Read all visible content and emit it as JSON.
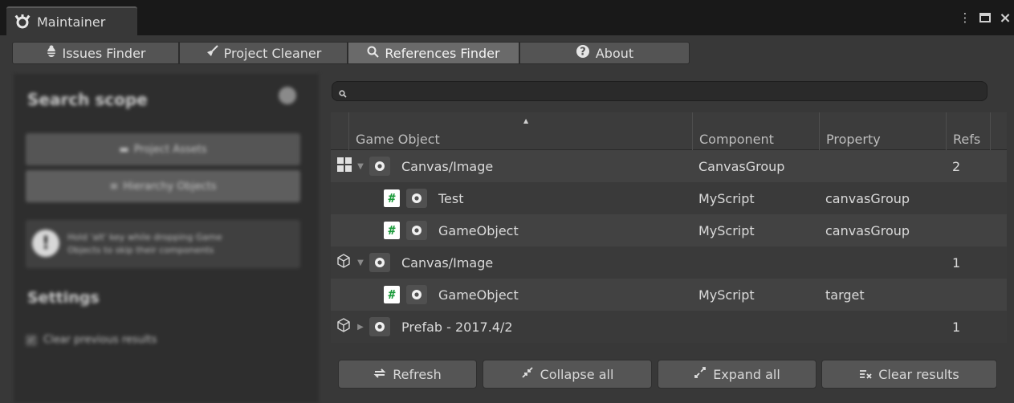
{
  "window": {
    "title": "Maintainer",
    "controls": {
      "menu": "⋮",
      "maximize": "□",
      "close": "×"
    }
  },
  "tabs": [
    {
      "label": "Issues Finder",
      "icon": "bug-icon"
    },
    {
      "label": "Project Cleaner",
      "icon": "broom-icon"
    },
    {
      "label": "References Finder",
      "icon": "search-icon",
      "active": true
    },
    {
      "label": "About",
      "icon": "help-icon"
    }
  ],
  "left_panel": {
    "search_scope_title": "Search scope",
    "project_assets_label": "Project Assets",
    "hierarchy_objects_label": "Hierarchy Objects",
    "note_line1": "Hold 'alt' key while dropping Game",
    "note_line2": "Objects to skip their components",
    "settings_title": "Settings",
    "clear_previous_label": "Clear previous results"
  },
  "search": {
    "placeholder": "",
    "value": ""
  },
  "table": {
    "columns": {
      "game_object": "Game Object",
      "component": "Component",
      "property": "Property",
      "refs": "Refs"
    },
    "sort_indicator": "▲",
    "rows": [
      {
        "icon": "scene-grid-icon",
        "expander": "▼",
        "name": "Canvas/Image",
        "component": "CanvasGroup",
        "property": "",
        "refs": "2"
      },
      {
        "icon": "script-icon",
        "name": "Test",
        "component": "MyScript",
        "property": "canvasGroup",
        "refs": ""
      },
      {
        "icon": "script-icon",
        "name": "GameObject",
        "component": "MyScript",
        "property": "canvasGroup",
        "refs": ""
      },
      {
        "icon": "prefab-cube-icon",
        "expander": "▼",
        "name": "Canvas/Image",
        "component": "",
        "property": "",
        "refs": "1"
      },
      {
        "icon": "script-icon",
        "name": "GameObject",
        "component": "MyScript",
        "property": "target",
        "refs": ""
      },
      {
        "icon": "prefab-cube-icon",
        "expander": "▶",
        "name": "Prefab - 2017.4/2",
        "component": "",
        "property": "",
        "refs": "1"
      }
    ]
  },
  "buttons": {
    "refresh": "Refresh",
    "collapse_all": "Collapse all",
    "expand_all": "Expand all",
    "clear_results": "Clear results"
  },
  "colors": {
    "panel": "#383838",
    "row_odd": "#424242",
    "row_even": "#3a3a3a",
    "script_green": "#1b9a3a"
  }
}
